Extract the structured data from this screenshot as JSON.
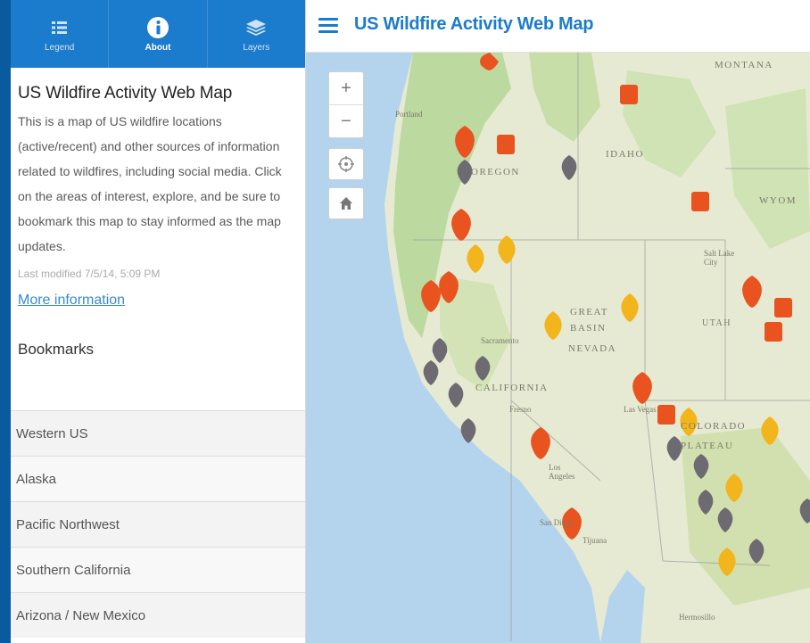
{
  "tabs": [
    {
      "label": "Legend",
      "icon": "list-icon",
      "active": false
    },
    {
      "label": "About",
      "icon": "info-icon",
      "active": true
    },
    {
      "label": "Layers",
      "icon": "layers-icon",
      "active": false
    }
  ],
  "about": {
    "title": "US Wildfire Activity Web Map",
    "description": "This is a map of US wildfire locations (active/recent) and other sources of information related to wildfires, including social media. Click on the areas of interest, explore, and be sure to bookmark this map to stay informed as the map updates.",
    "last_modified": "Last modified 7/5/14, 5:09 PM",
    "more_info": "More information"
  },
  "bookmarks": {
    "title": "Bookmarks",
    "items": [
      "Western US",
      "Alaska",
      "Pacific Northwest",
      "Southern California",
      "Arizona / New Mexico"
    ]
  },
  "header": {
    "title": "US Wildfire Activity Web Map"
  },
  "map_controls": {
    "zoom_in": "+",
    "zoom_out": "−"
  },
  "map_labels": {
    "montana": "MONTANA",
    "idaho": "IDAHO",
    "oregon": "OREGON",
    "wyoming": "WYOM",
    "portland": "Portland",
    "salt_lake": "Salt Lake City",
    "utah": "UTAH",
    "great_basin": "GREAT BASIN",
    "nevada": "NEVADA",
    "california": "CALIFORNIA",
    "fresno": "Fresno",
    "sacramento": "Sacramento",
    "los_angeles": "Los Angeles",
    "san_diego": "San Diego",
    "tijuana": "Tijuana",
    "las_vegas": "Las Vegas",
    "colorado_plateau": "COLORADO PLATEAU",
    "hermosillo": "Hermosillo"
  },
  "colors": {
    "brand": "#1b7bcc",
    "fire_active": "#e8531f",
    "fire_yellow": "#f2b51c",
    "fire_inactive": "#6e6a72",
    "ocean": "#b4d4ee",
    "land": "#e6ead3",
    "forest": "#bcd99f",
    "alert": "#e8531f"
  }
}
